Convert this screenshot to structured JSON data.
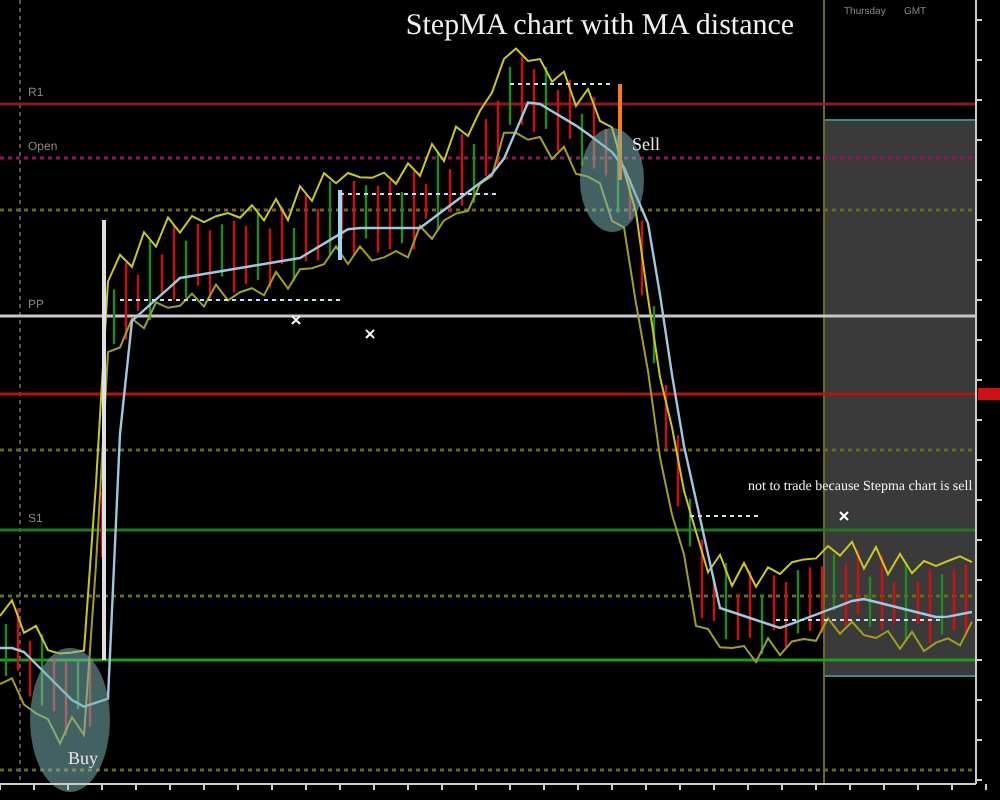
{
  "chart": {
    "title": "StepMA chart with MA distance",
    "session_labels": [
      "Thursday",
      "GMT"
    ],
    "levels": [
      {
        "label": "R1",
        "color": "#8b1a1a",
        "dashed": false
      },
      {
        "label": "Open",
        "color": "#8b1a5a",
        "dashed": true
      },
      {
        "color": "#6b6b1a",
        "dashed": true
      },
      {
        "label": "PP",
        "color": "#c8c8c8",
        "dashed": false
      },
      {
        "color": "#b01515",
        "dashed": false
      },
      {
        "color": "#6b6b1a",
        "dashed": true
      },
      {
        "label": "S1",
        "color": "#1f7a1f",
        "dashed": false
      },
      {
        "color": "#6b6b1a",
        "dashed": true
      },
      {
        "color": "#1f9a1f",
        "dashed": false
      },
      {
        "color": "#6b6b1a",
        "dashed": true
      }
    ],
    "annotations": [
      {
        "kind": "circle",
        "label": "Sell"
      },
      {
        "kind": "circle",
        "label": "Buy"
      },
      {
        "kind": "note",
        "label": "not to trade because Stepma chart is sell"
      }
    ]
  }
}
